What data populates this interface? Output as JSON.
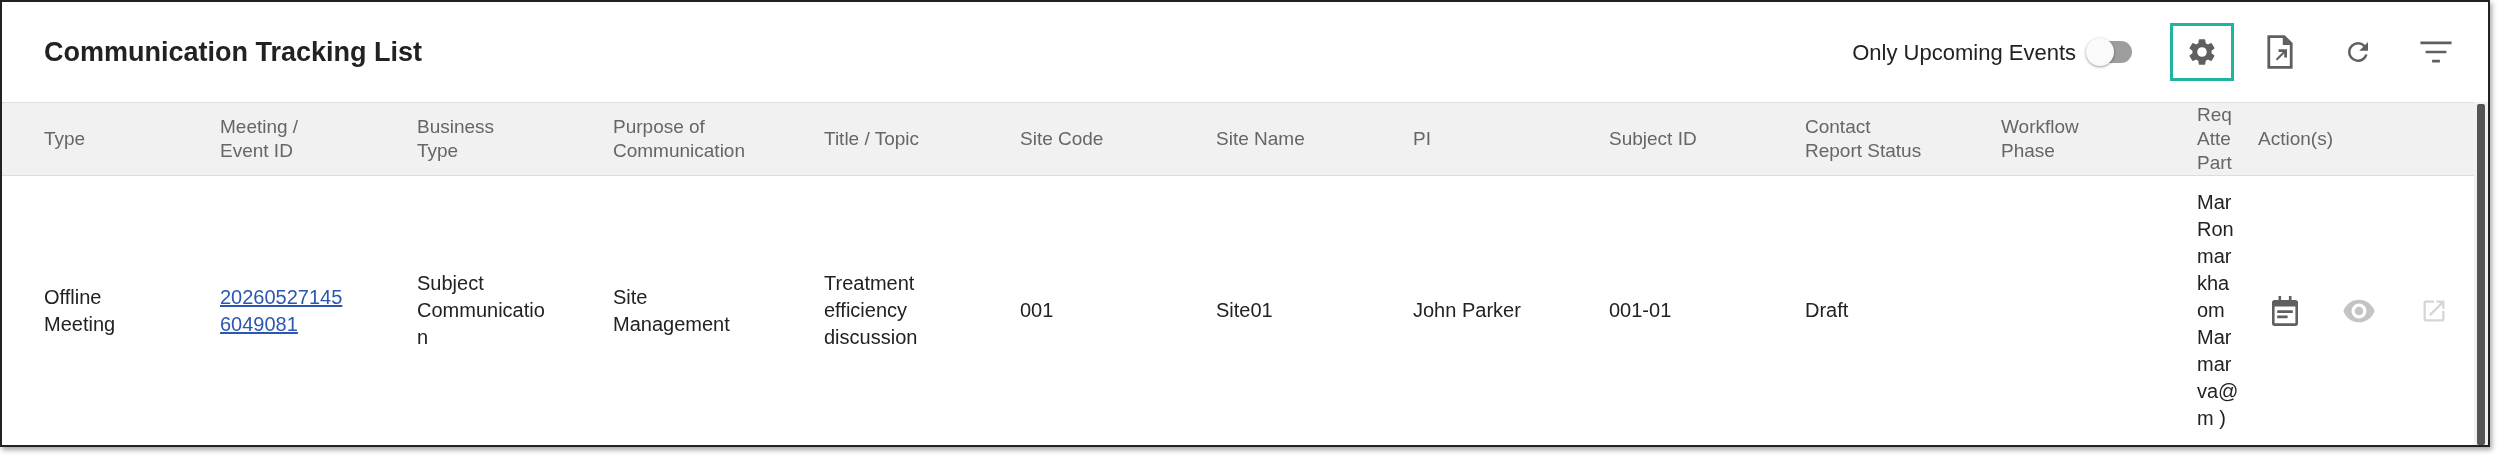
{
  "title": "Communication Tracking List",
  "toolbar": {
    "toggle": {
      "label": "Only Upcoming Events",
      "on": false
    },
    "buttons": [
      {
        "kind": "settings",
        "focused": true
      },
      {
        "kind": "export",
        "focused": false
      },
      {
        "kind": "refresh",
        "focused": false
      },
      {
        "kind": "filter",
        "focused": false
      }
    ]
  },
  "table": {
    "columns": [
      {
        "lines": [
          "Type"
        ]
      },
      {
        "lines": [
          "Meeting /",
          "Event ID"
        ]
      },
      {
        "lines": [
          "Business",
          "Type"
        ]
      },
      {
        "lines": [
          "Purpose of",
          "Communication"
        ]
      },
      {
        "lines": [
          "Title / Topic"
        ]
      },
      {
        "lines": [
          "Site Code"
        ]
      },
      {
        "lines": [
          "Site Name"
        ]
      },
      {
        "lines": [
          "PI"
        ]
      },
      {
        "lines": [
          "Subject ID"
        ]
      },
      {
        "lines": [
          "Contact",
          "Report Status"
        ]
      },
      {
        "lines": [
          "Workflow",
          "Phase"
        ]
      },
      {
        "lines": [
          "Req",
          "Atte",
          "Part"
        ]
      },
      {
        "lines": [
          "Action(s)"
        ]
      }
    ],
    "rows": [
      {
        "cells": [
          {
            "kind": "text",
            "lines": [
              "Offline",
              "Meeting"
            ]
          },
          {
            "kind": "link",
            "lines": [
              "20260527145",
              "6049081"
            ]
          },
          {
            "kind": "text",
            "lines": [
              "Subject",
              "Communicatio",
              "n"
            ]
          },
          {
            "kind": "text",
            "lines": [
              "Site",
              "Management"
            ]
          },
          {
            "kind": "text",
            "lines": [
              "Treatment",
              "efficiency",
              "discussion"
            ]
          },
          {
            "kind": "text",
            "lines": [
              "001"
            ]
          },
          {
            "kind": "text",
            "lines": [
              "Site01"
            ]
          },
          {
            "kind": "text",
            "lines": [
              "John Parker"
            ]
          },
          {
            "kind": "text",
            "lines": [
              "001-01"
            ]
          },
          {
            "kind": "text",
            "lines": [
              "Draft"
            ]
          },
          {
            "kind": "empty"
          },
          {
            "kind": "text",
            "lines": [
              "Mar",
              "Ron",
              "mar",
              "kha",
              "om",
              "Mar",
              "mar",
              "va@",
              "m )"
            ]
          }
        ],
        "actions": [
          {
            "kind": "calendar",
            "disabled": false
          },
          {
            "kind": "view",
            "disabled": true
          },
          {
            "kind": "open",
            "disabled": true
          }
        ]
      }
    ]
  }
}
